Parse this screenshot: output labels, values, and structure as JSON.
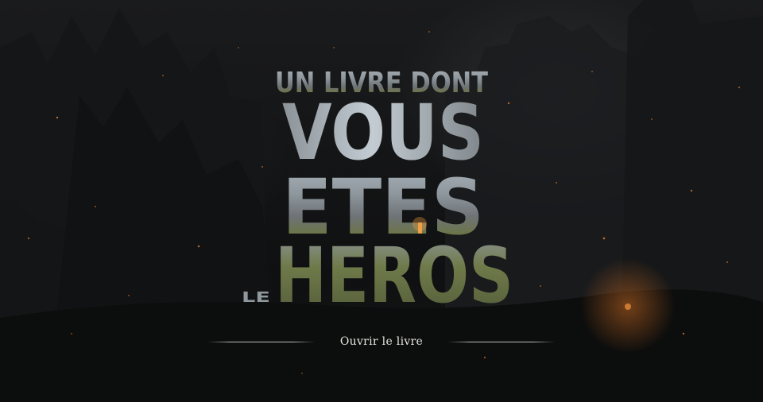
{
  "title": {
    "line1": "UN LIVRE DONT",
    "line2": "VOUS",
    "line3": "ETES",
    "prefix": "LE",
    "line4": "HEROS"
  },
  "menu": {
    "open_book_label": "Ouvrir le livre"
  },
  "colors": {
    "background": "#0b0c0d",
    "title_grey": "#9aa3a9",
    "ember": "#d9782c",
    "torch": "#f0a040",
    "moss": "#5f6e3a",
    "menu_text": "#e6e4df"
  }
}
